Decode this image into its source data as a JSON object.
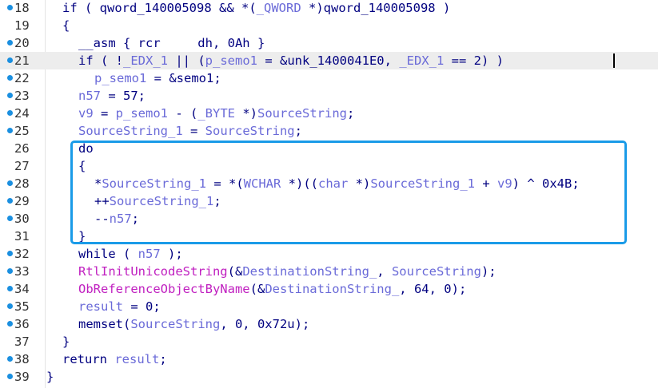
{
  "lines": [
    {
      "num": "18",
      "dot": true,
      "indent": 78,
      "tokens": [
        [
          "k",
          "if ( "
        ],
        [
          "c",
          "qword_140005098"
        ],
        [
          "k",
          " && *("
        ],
        [
          "v",
          "_QWORD"
        ],
        [
          "k",
          " *)"
        ],
        [
          "c",
          "qword_140005098"
        ],
        [
          "k",
          " )"
        ]
      ]
    },
    {
      "num": "19",
      "dot": false,
      "indent": 78,
      "tokens": [
        [
          "k",
          "{"
        ]
      ]
    },
    {
      "num": "20",
      "dot": true,
      "indent": 98,
      "tokens": [
        [
          "k",
          "__asm { rcr     dh, 0Ah }"
        ]
      ]
    },
    {
      "num": "21",
      "dot": true,
      "indent": 98,
      "highlight": true,
      "caret": true,
      "tokens": [
        [
          "k",
          "if ( !"
        ],
        [
          "v",
          "_EDX_1"
        ],
        [
          "k",
          " || ("
        ],
        [
          "v",
          "p_semo1"
        ],
        [
          "k",
          " = &unk_1400041E0, "
        ],
        [
          "v",
          "_EDX_1"
        ],
        [
          "k",
          " == 2) )"
        ]
      ]
    },
    {
      "num": "22",
      "dot": true,
      "indent": 118,
      "tokens": [
        [
          "v",
          "p_semo1"
        ],
        [
          "k",
          " = &semo1;"
        ]
      ]
    },
    {
      "num": "23",
      "dot": true,
      "indent": 98,
      "tokens": [
        [
          "v",
          "n57"
        ],
        [
          "k",
          " = 57;"
        ]
      ]
    },
    {
      "num": "24",
      "dot": true,
      "indent": 98,
      "tokens": [
        [
          "v",
          "v9"
        ],
        [
          "k",
          " = "
        ],
        [
          "v",
          "p_semo1"
        ],
        [
          "k",
          " - ("
        ],
        [
          "v",
          "_BYTE"
        ],
        [
          "k",
          " *)"
        ],
        [
          "v",
          "SourceString"
        ],
        [
          "k",
          ";"
        ]
      ]
    },
    {
      "num": "25",
      "dot": true,
      "indent": 98,
      "tokens": [
        [
          "v",
          "SourceString_1"
        ],
        [
          "k",
          " = "
        ],
        [
          "v",
          "SourceString"
        ],
        [
          "k",
          ";"
        ]
      ]
    },
    {
      "num": "26",
      "dot": false,
      "indent": 98,
      "tokens": [
        [
          "k",
          "do"
        ]
      ]
    },
    {
      "num": "27",
      "dot": false,
      "indent": 98,
      "tokens": [
        [
          "k",
          "{"
        ]
      ]
    },
    {
      "num": "28",
      "dot": true,
      "indent": 118,
      "tokens": [
        [
          "k",
          "*"
        ],
        [
          "v",
          "SourceString_1"
        ],
        [
          "k",
          " = *("
        ],
        [
          "v",
          "WCHAR"
        ],
        [
          "k",
          " *)(("
        ],
        [
          "v",
          "char"
        ],
        [
          "k",
          " *)"
        ],
        [
          "v",
          "SourceString_1"
        ],
        [
          "k",
          " + "
        ],
        [
          "v",
          "v9"
        ],
        [
          "k",
          ") ^ 0x4B;"
        ]
      ]
    },
    {
      "num": "29",
      "dot": true,
      "indent": 118,
      "tokens": [
        [
          "k",
          "++"
        ],
        [
          "v",
          "SourceString_1"
        ],
        [
          "k",
          ";"
        ]
      ]
    },
    {
      "num": "30",
      "dot": true,
      "indent": 118,
      "tokens": [
        [
          "k",
          "--"
        ],
        [
          "v",
          "n57"
        ],
        [
          "k",
          ";"
        ]
      ]
    },
    {
      "num": "31",
      "dot": false,
      "indent": 98,
      "tokens": [
        [
          "k",
          "}"
        ]
      ]
    },
    {
      "num": "32",
      "dot": true,
      "indent": 98,
      "tokens": [
        [
          "k",
          "while ( "
        ],
        [
          "v",
          "n57"
        ],
        [
          "k",
          " );"
        ]
      ]
    },
    {
      "num": "33",
      "dot": true,
      "indent": 98,
      "tokens": [
        [
          "f",
          "RtlInitUnicodeString"
        ],
        [
          "k",
          "(&"
        ],
        [
          "v",
          "DestinationString_"
        ],
        [
          "k",
          ", "
        ],
        [
          "v",
          "SourceString"
        ],
        [
          "k",
          ");"
        ]
      ]
    },
    {
      "num": "34",
      "dot": true,
      "indent": 98,
      "tokens": [
        [
          "f",
          "ObReferenceObjectByName"
        ],
        [
          "k",
          "(&"
        ],
        [
          "v",
          "DestinationString_"
        ],
        [
          "k",
          ", 64, 0);"
        ]
      ]
    },
    {
      "num": "35",
      "dot": true,
      "indent": 98,
      "tokens": [
        [
          "v",
          "result"
        ],
        [
          "k",
          " = 0;"
        ]
      ]
    },
    {
      "num": "36",
      "dot": true,
      "indent": 98,
      "tokens": [
        [
          "k",
          "memset("
        ],
        [
          "v",
          "SourceString"
        ],
        [
          "k",
          ", 0, 0x72u);"
        ]
      ]
    },
    {
      "num": "37",
      "dot": false,
      "indent": 78,
      "tokens": [
        [
          "k",
          "}"
        ]
      ]
    },
    {
      "num": "38",
      "dot": true,
      "indent": 78,
      "tokens": [
        [
          "k",
          "return "
        ],
        [
          "v",
          "result"
        ],
        [
          "k",
          ";"
        ]
      ]
    },
    {
      "num": "39",
      "dot": true,
      "indent": 58,
      "tokens": [
        [
          "k",
          "}"
        ]
      ]
    }
  ]
}
